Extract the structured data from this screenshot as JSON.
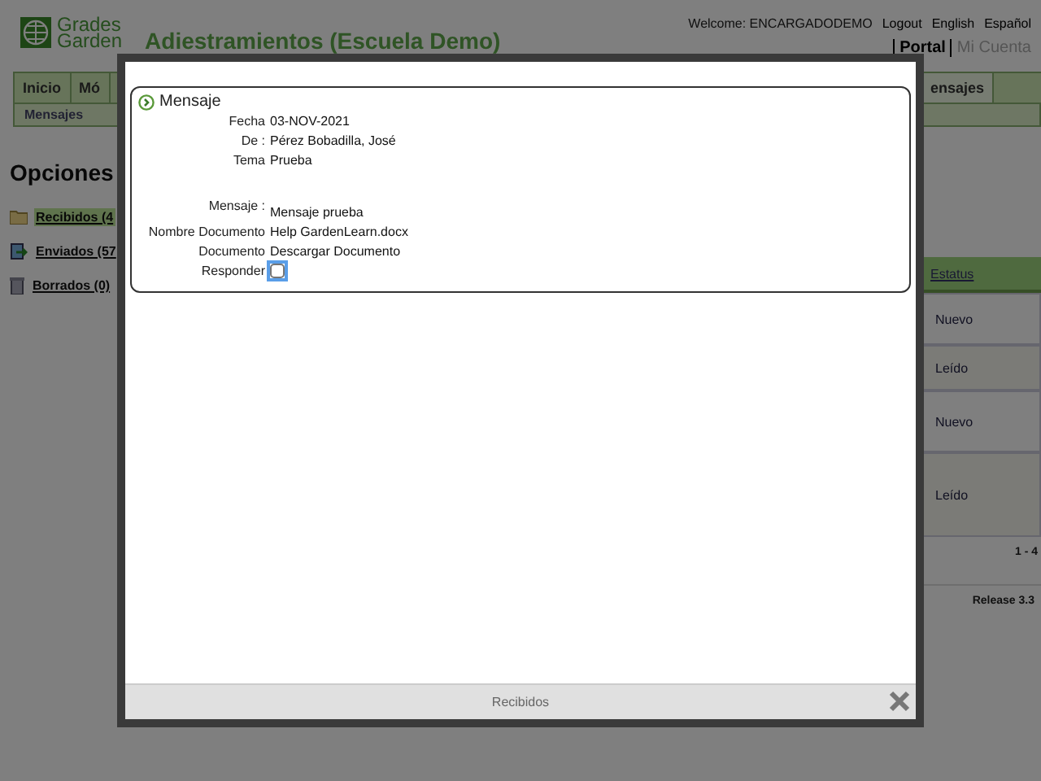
{
  "header": {
    "logo": [
      "Grades",
      "Garden"
    ],
    "title": "Adiestramientos (Escuela Demo)",
    "welcome": "Welcome: ENCARGADODEMO",
    "links": [
      "Logout",
      "English",
      "Español"
    ],
    "account_links": [
      {
        "label": "Portal",
        "selected": true
      },
      {
        "label": "Mi Cuenta",
        "selected": false
      }
    ]
  },
  "nav": {
    "tabs": [
      {
        "label": "Inicio",
        "selected": false
      },
      {
        "label": "Mó",
        "selected": false
      },
      {
        "label": "ensajes",
        "selected": true
      }
    ],
    "subtab": "Mensajes"
  },
  "options": {
    "heading": "Opciones",
    "folders": [
      {
        "label": "Recibidos (4",
        "kind": "inbox",
        "selected": true
      },
      {
        "label": "Enviados (57",
        "kind": "sent",
        "selected": false
      },
      {
        "label": "Borrados (0)",
        "kind": "trash",
        "selected": false
      }
    ]
  },
  "table": {
    "column": "Estatus",
    "rows": [
      "Nuevo",
      "Leído",
      "Nuevo",
      "Leído"
    ],
    "range": "1 - 4"
  },
  "release": "Release 3.3",
  "modal": {
    "panel_title": "Mensaje",
    "fields": [
      {
        "label": "Fecha",
        "kind": "text",
        "value": "03-NOV-2021"
      },
      {
        "label": "De :",
        "kind": "text",
        "value": "Pérez Bobadilla, José"
      },
      {
        "label": "Tema",
        "kind": "text",
        "value": "Prueba"
      },
      {
        "label": "Mensaje :",
        "kind": "message",
        "value": "Mensaje prueba"
      },
      {
        "label": "Nombre Documento",
        "kind": "text",
        "value": "Help GardenLearn.docx"
      },
      {
        "label": "Documento",
        "kind": "link",
        "value": "Descargar Documento"
      },
      {
        "label": "Responder",
        "kind": "checkbox",
        "checked": false
      }
    ],
    "footer_title": "Recibidos"
  }
}
